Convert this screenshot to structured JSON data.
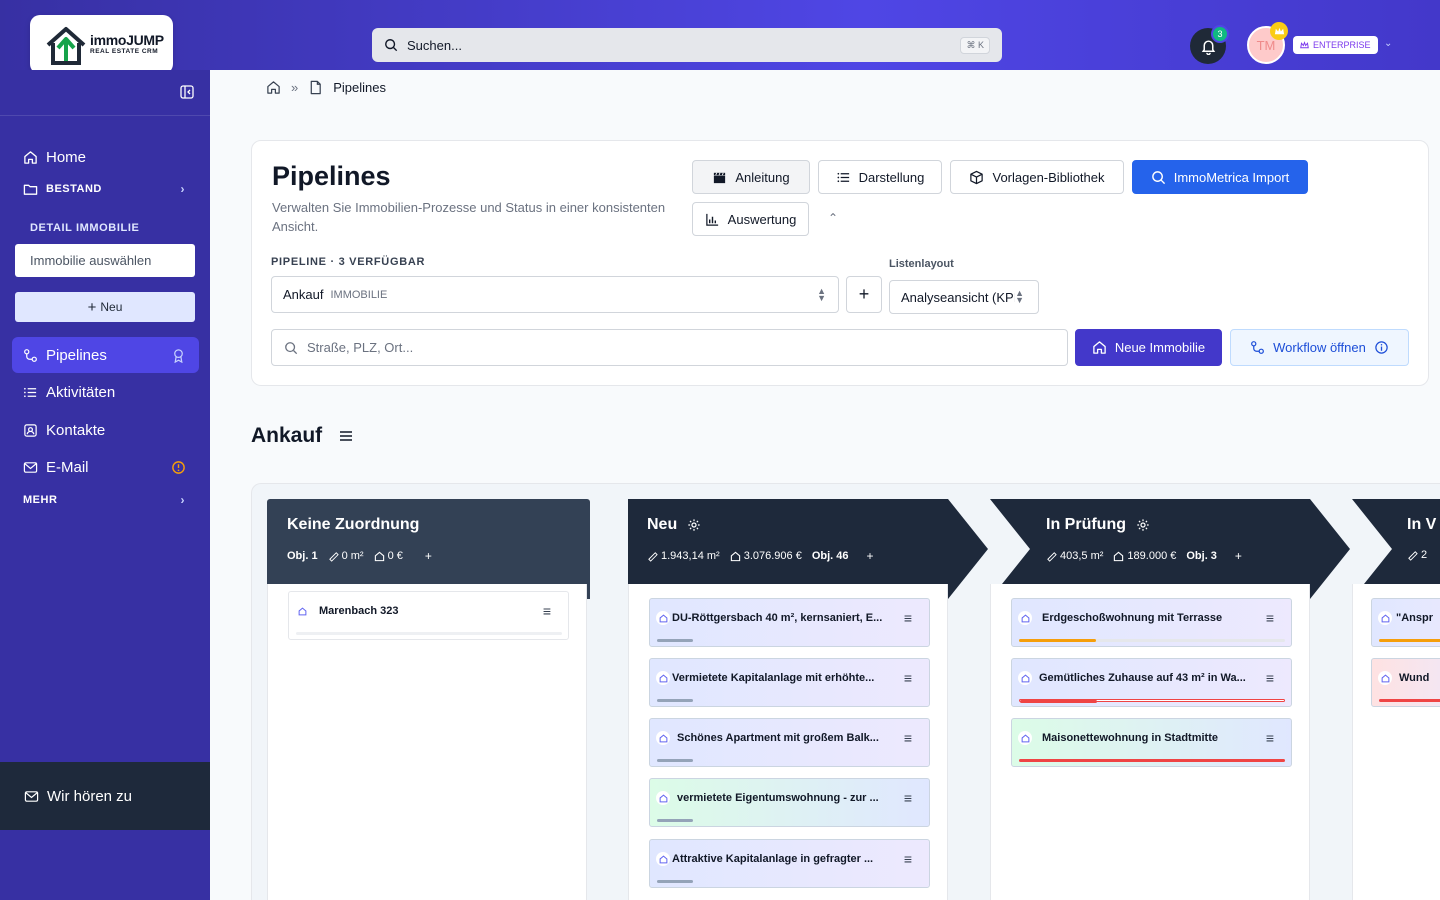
{
  "brand": {
    "name": "immoJUMP",
    "tagline": "REAL ESTATE CRM"
  },
  "search": {
    "placeholder": "Suchen...",
    "shortcut": "⌘ K"
  },
  "notifications": {
    "count": "3"
  },
  "user": {
    "initials": "TM",
    "plan": "ENTERPRISE"
  },
  "sidebar": {
    "home": "Home",
    "bestand": "BESTAND",
    "detail_label": "DETAIL IMMOBILIE",
    "select_placeholder": "Immobilie auswählen",
    "new_label": "Neu",
    "pipelines": "Pipelines",
    "aktivitaeten": "Aktivitäten",
    "kontakte": "Kontakte",
    "email": "E-Mail",
    "mehr": "MEHR",
    "feedback": "Wir hören zu"
  },
  "breadcrumb": {
    "current": "Pipelines"
  },
  "header": {
    "title": "Pipelines",
    "subtitle": "Verwalten Sie Immobilien-Prozesse und Status in einer konsistenten Ansicht.",
    "buttons": {
      "anleitung": "Anleitung",
      "darstellung": "Darstellung",
      "vorlagen": "Vorlagen-Bibliothek",
      "import": "ImmoMetrica Import",
      "auswertung": "Auswertung"
    },
    "pipeline_label": "PIPELINE · 3 VERFÜGBAR",
    "pipeline_value": "Ankauf",
    "pipeline_tag": "IMMOBILIE",
    "layout_label": "Listenlayout",
    "layout_value": "Analyseansicht (KPI",
    "address_placeholder": "Straße, PLZ, Ort...",
    "new_property": "Neue Immobilie",
    "open_workflow": "Workflow öffnen"
  },
  "section": {
    "title": "Ankauf"
  },
  "colors": {
    "accent": "#4f46e5",
    "sidebar": "#3730a3",
    "primary": "#2563eb",
    "column_dark": "#1e293b"
  },
  "columns": [
    {
      "title": "Keine Zuordnung",
      "obj": "Obj. 1",
      "area": "0 m²",
      "value": "0 €",
      "items": [
        {
          "label": "Marenbach 323"
        }
      ]
    },
    {
      "title": "Neu",
      "obj": "Obj. 46",
      "area": "1.943,14 m²",
      "value": "3.076.906 €",
      "items": [
        {
          "label": "DU-Röttgersbach 40 m², kernsaniert, E..."
        },
        {
          "label": "Vermietete Kapitalanlage mit erhöhte..."
        },
        {
          "label": "Schönes Apartment mit großem Balk..."
        },
        {
          "label": "vermietete Eigentumswohnung - zur ..."
        },
        {
          "label": "Attraktive Kapitalanlage in gefragter ..."
        }
      ]
    },
    {
      "title": "In Prüfung",
      "obj": "Obj. 3",
      "area": "403,5 m²",
      "value": "189.000 €",
      "items": [
        {
          "label": "Erdgeschoßwohnung mit Terrasse"
        },
        {
          "label": "Gemütliches Zuhause auf 43 m² in Wa..."
        },
        {
          "label": "Maisonettewohnung in Stadtmitte"
        }
      ]
    },
    {
      "title": "In V",
      "area": "2",
      "items": [
        {
          "label": "\"Anspr"
        },
        {
          "label": "Wund"
        }
      ]
    }
  ]
}
